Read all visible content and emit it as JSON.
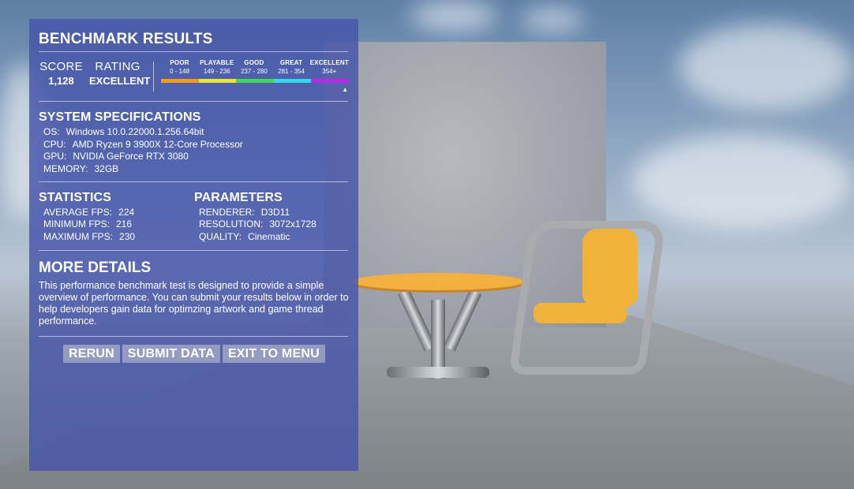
{
  "panel": {
    "title": "BENCHMARK RESULTS",
    "score_label": "SCORE",
    "score_value": "1,128",
    "rating_label": "RATING",
    "rating_value": "EXCELLENT",
    "scale": [
      {
        "name": "POOR",
        "range": "0 - 148",
        "color": "#f39a1c"
      },
      {
        "name": "PLAYABLE",
        "range": "149 - 236",
        "color": "#e8e43a"
      },
      {
        "name": "GOOD",
        "range": "237 - 280",
        "color": "#3fd85a"
      },
      {
        "name": "GREAT",
        "range": "281 - 354",
        "color": "#35d8e8"
      },
      {
        "name": "EXCELLENT",
        "range": "354+",
        "color": "#b22ee0"
      }
    ],
    "scale_marker": "▲",
    "system": {
      "title": "SYSTEM SPECIFICATIONS",
      "os_label": "OS:",
      "os_value": "Windows 10.0.22000.1.256.64bit",
      "cpu_label": "CPU:",
      "cpu_value": "AMD Ryzen 9 3900X 12-Core Processor",
      "gpu_label": "GPU:",
      "gpu_value": "NVIDIA GeForce RTX 3080",
      "memory_label": "MEMORY:",
      "memory_value": "32GB"
    },
    "statistics": {
      "title": "STATISTICS",
      "avg_label": "AVERAGE FPS:",
      "avg_value": "224",
      "min_label": "MINIMUM FPS:",
      "min_value": "216",
      "max_label": "MAXIMUM FPS:",
      "max_value": "230"
    },
    "parameters": {
      "title": "PARAMETERS",
      "renderer_label": "RENDERER:",
      "renderer_value": "D3D11",
      "resolution_label": "RESOLUTION:",
      "resolution_value": "3072x1728",
      "quality_label": "QUALITY:",
      "quality_value": "Cinematic"
    },
    "details": {
      "title": "MORE DETAILS",
      "text": "This performance benchmark test is designed to provide a simple overview of performance. You can submit your results below in order to help developers gain data for optimzing artwork and game thread performance."
    },
    "buttons": {
      "rerun": "RERUN",
      "submit": "SUBMIT DATA",
      "exit": "EXIT TO MENU"
    }
  }
}
